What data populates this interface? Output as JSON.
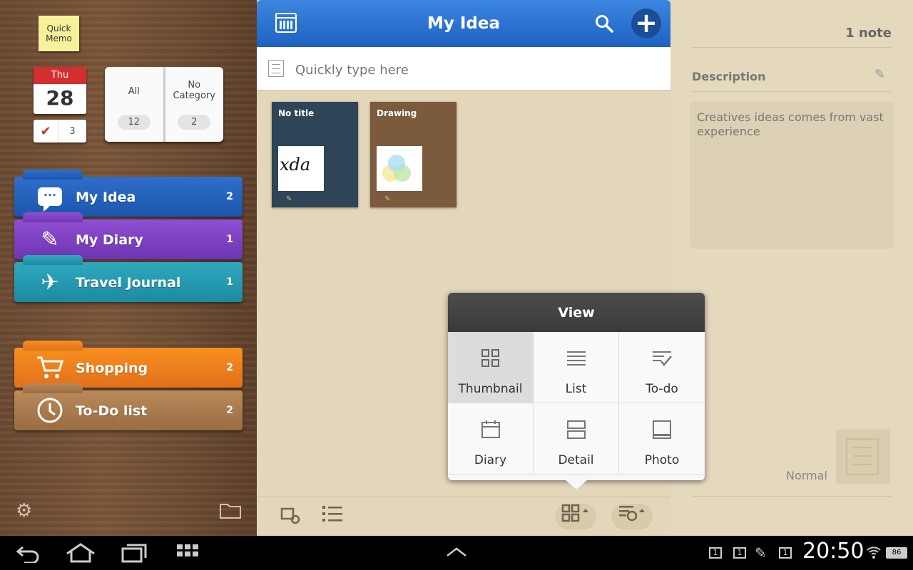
{
  "sidebar": {
    "quick_memo": "Quick\nMemo",
    "calendar": {
      "day": "Thu",
      "date": "28"
    },
    "todo_count": "3",
    "book": {
      "all_label": "All",
      "all_count": "12",
      "nocat_label": "No\nCategory",
      "nocat_count": "2"
    },
    "categories": [
      {
        "label": "My Idea",
        "count": "2",
        "icon": "chat-bubble-icon",
        "color": "#2f6ecb"
      },
      {
        "label": "My Diary",
        "count": "1",
        "icon": "pencil-icon",
        "color": "#8f4fd2"
      },
      {
        "label": "Travel Journal",
        "count": "1",
        "icon": "airplane-icon",
        "color": "#2fa9bf"
      },
      {
        "label": "Shopping",
        "count": "2",
        "icon": "shopping-cart-icon",
        "color": "#f7901f"
      },
      {
        "label": "To-Do list",
        "count": "2",
        "icon": "clock-icon",
        "color": "#b98a5a"
      }
    ]
  },
  "header": {
    "title": "My Idea"
  },
  "quick_input": {
    "placeholder": "Quickly type here"
  },
  "notes": [
    {
      "title": "No title",
      "preview": "xda"
    },
    {
      "title": "Drawing",
      "preview": ""
    }
  ],
  "detail": {
    "note_count": "1 note",
    "description_label": "Description",
    "description_text": "Creatives ideas comes from vast experience",
    "style_label": "Normal"
  },
  "view_popup": {
    "title": "View",
    "options": [
      {
        "label": "Thumbnail",
        "selected": true
      },
      {
        "label": "List",
        "selected": false
      },
      {
        "label": "To-do",
        "selected": false
      },
      {
        "label": "Diary",
        "selected": false
      },
      {
        "label": "Detail",
        "selected": false
      },
      {
        "label": "Photo",
        "selected": false
      }
    ]
  },
  "status_bar": {
    "time": "20:50",
    "battery": "86"
  }
}
